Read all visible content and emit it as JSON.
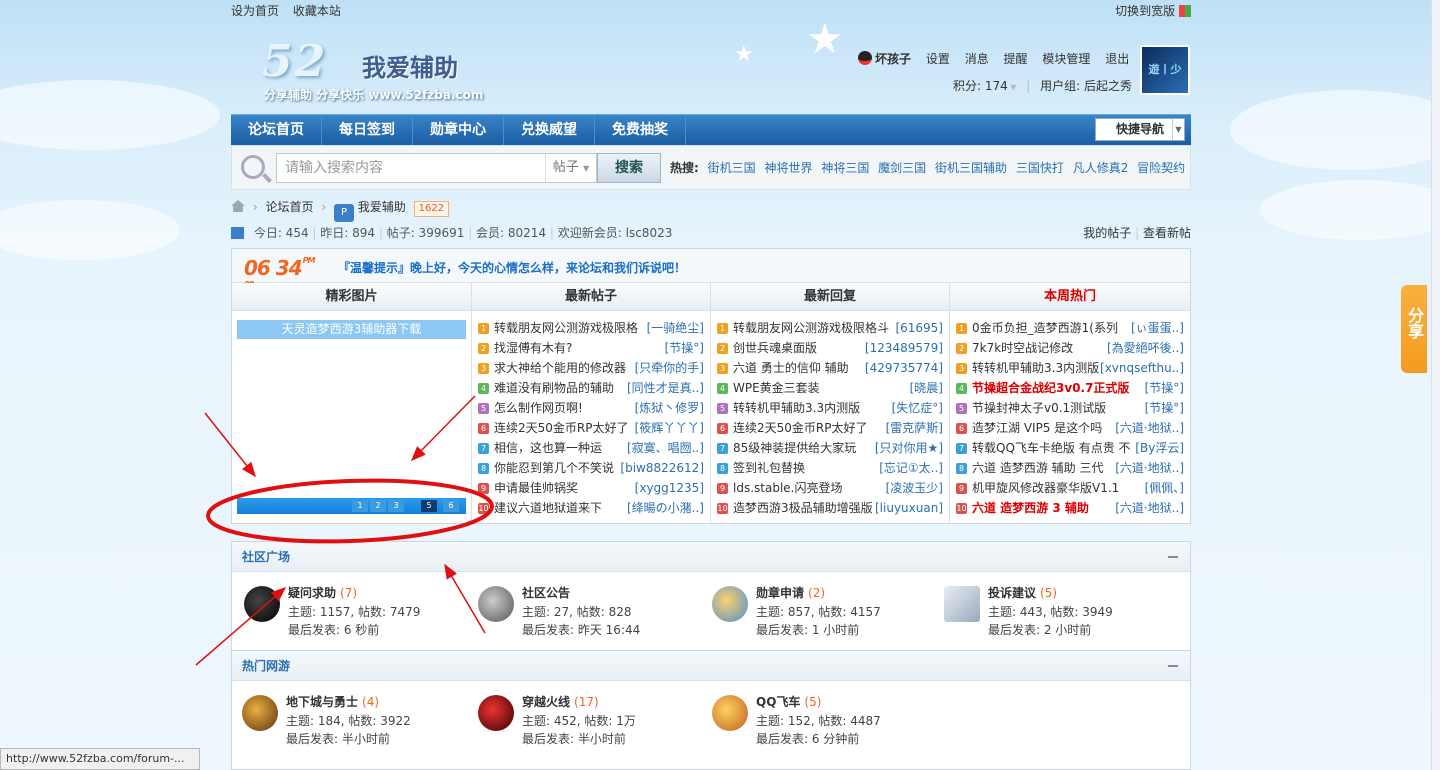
{
  "topbar": {
    "set_home": "设为首页",
    "bookmark": "收藏本站",
    "switch_width": "切换到宽版"
  },
  "logo": {
    "number": "52",
    "title": "我爱辅助",
    "slogan": "分享辅助  分享快乐  www.52fzba.com"
  },
  "user": {
    "name": "坏孩子",
    "settings": "设置",
    "messages": "消息",
    "reminders": "提醒",
    "module_admin": "模块管理",
    "logout": "退出",
    "points": "积分: 174",
    "group": "用户组: 后起之秀",
    "avatar_text": "遊丨少"
  },
  "nav": {
    "items": [
      "论坛首页",
      "每日签到",
      "勋章中心",
      "兑换威望",
      "免费抽奖"
    ],
    "quick_nav": "快捷导航"
  },
  "search": {
    "placeholder": "请输入搜索内容",
    "type": "帖子",
    "button": "搜索",
    "hot_label": "热搜:",
    "hot": [
      "街机三国",
      "神将世界",
      "神将三国",
      "魔剑三国",
      "街机三国辅助",
      "三国快打",
      "凡人修真2",
      "冒险契约"
    ]
  },
  "breadcrumb": {
    "home": "论坛首页",
    "forum": "我爱辅助",
    "count": "1622"
  },
  "stats": {
    "today": "今日: 454",
    "yesterday": "昨日: 894",
    "posts": "帖子: 399691",
    "members": "会员: 80214",
    "newest": "欢迎新会员: lsc8023",
    "my_posts": "我的帖子",
    "new_posts": "查看新帖"
  },
  "tip": {
    "clock": "06 34",
    "ampm": "PM",
    "sec": "08",
    "text": "『温馨提示』晚上好，今天的心情怎么样，来论坛和我们诉说吧！"
  },
  "columns": {
    "pics": {
      "title": "精彩图片",
      "caption": "天灵造梦西游3辅助器下载",
      "pages": [
        "1",
        "2",
        "3",
        "5",
        "6"
      ]
    },
    "latest_posts": {
      "title": "最新帖子",
      "rows": [
        {
          "t": "转载朋友网公测游戏极限格",
          "a": "[一骑绝尘]"
        },
        {
          "t": "找湿傅有木有?",
          "a": "[节操°]"
        },
        {
          "t": "求大神给个能用的修改器",
          "a": "[只牵你的手]"
        },
        {
          "t": "难道没有刷物品的辅助",
          "a": "[同性才是真..]"
        },
        {
          "t": "怎么制作网页啊!",
          "a": "[炼狱丶修罗]"
        },
        {
          "t": "连续2天50金币RP太好了",
          "a": "[筱辉丫丫丫]"
        },
        {
          "t": "相信，这也算一种运",
          "a": "[寂寞、唱囫..]"
        },
        {
          "t": "你能忍到第几个不笑说",
          "a": "[biw8822612]"
        },
        {
          "t": "申请最佳帅锅奖",
          "a": "[xygg1235]"
        },
        {
          "t": "建议六道地狱道来下",
          "a": "[绛暘の小潴..]"
        }
      ]
    },
    "latest_replies": {
      "title": "最新回复",
      "rows": [
        {
          "t": "转载朋友网公测游戏极限格斗",
          "a": "[61695]"
        },
        {
          "t": "创世兵魂桌面版",
          "a": "[123489579]"
        },
        {
          "t": "六道 勇士的信仰 辅助",
          "a": "[429735774]"
        },
        {
          "t": "WPE黄金三套装",
          "a": "[晓晨]"
        },
        {
          "t": "转转机甲辅助3.3内测版",
          "a": "[失忆症°]"
        },
        {
          "t": "连续2天50金币RP太好了",
          "a": "[雷克萨斯]"
        },
        {
          "t": "85级神装提供给大家玩",
          "a": "[只对你用★]"
        },
        {
          "t": "签到礼包替换",
          "a": "[忘记①太..]"
        },
        {
          "t": "lds.stable.闪亮登场",
          "a": "[凌波玉少]"
        },
        {
          "t": "造梦西游3极品辅助增强版",
          "a": "[liuyuxuan]"
        }
      ]
    },
    "weekly_hot": {
      "title": "本周热门",
      "rows": [
        {
          "t": "0金币负担_造梦西游1(系列",
          "a": "[ぃ蛋蛋..]"
        },
        {
          "t": "7k7k时空战记修改",
          "a": "[為愛絕吥後..]"
        },
        {
          "t": "转转机甲辅助3.3内测版",
          "a": "[xvnqsefthu..]"
        },
        {
          "t": "节操超合金战纪3v0.7正式版",
          "a": "[节操°]"
        },
        {
          "t": "节操封神太子v0.1测试版",
          "a": "[节操°]"
        },
        {
          "t": "造梦江湖 VIP5 是这个吗",
          "a": "[六道·地狱..]"
        },
        {
          "t": "转载QQ飞车卡绝版 有点贵 不",
          "a": "[By浮云]"
        },
        {
          "t": "六道 造梦西游 辅助 三代",
          "a": "[六道·地狱..]"
        },
        {
          "t": "机甲旋风修改器豪华版V1.1",
          "a": "[佩佩、]"
        },
        {
          "t": "六道 造梦西游 3 辅助",
          "a": "[六道·地狱..]"
        }
      ]
    }
  },
  "section1": {
    "title": "社区广场",
    "forums": [
      {
        "name": "疑问求助",
        "count": "(7)",
        "stats": "主题: 1157, 帖数: 7479",
        "last": "最后发表: 6 秒前"
      },
      {
        "name": "社区公告",
        "count": "",
        "stats": "主题: 27, 帖数: 828",
        "last": "最后发表: 昨天 16:44"
      },
      {
        "name": "勋章申请",
        "count": "(2)",
        "stats": "主题: 857, 帖数: 4157",
        "last": "最后发表: 1 小时前"
      },
      {
        "name": "投诉建议",
        "count": "(5)",
        "stats": "主题: 443, 帖数: 3949",
        "last": "最后发表: 2 小时前"
      }
    ]
  },
  "section2": {
    "title": "热门网游",
    "forums": [
      {
        "name": "地下城与勇士",
        "count": "(4)",
        "stats": "主题: 184, 帖数: 3922",
        "last": "最后发表: 半小时前"
      },
      {
        "name": "穿越火线",
        "count": "(17)",
        "stats": "主题: 452, 帖数: 1万",
        "last": "最后发表: 半小时前"
      },
      {
        "name": "QQ飞车",
        "count": "(5)",
        "stats": "主题: 152, 帖数: 4487",
        "last": "最后发表: 6 分钟前"
      }
    ]
  },
  "share": "分享",
  "status_url": "http://www.52fzba.com/forum-..."
}
